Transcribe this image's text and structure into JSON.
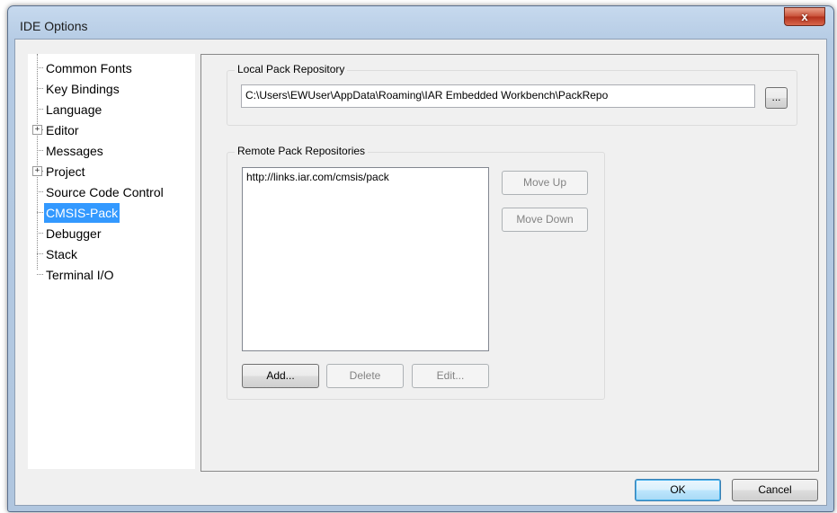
{
  "window": {
    "title": "IDE Options",
    "close_glyph": "x"
  },
  "tree": {
    "items": [
      {
        "label": "Common Fonts",
        "expandable": false,
        "selected": false
      },
      {
        "label": "Key Bindings",
        "expandable": false,
        "selected": false
      },
      {
        "label": "Language",
        "expandable": false,
        "selected": false
      },
      {
        "label": "Editor",
        "expandable": true,
        "selected": false
      },
      {
        "label": "Messages",
        "expandable": false,
        "selected": false
      },
      {
        "label": "Project",
        "expandable": true,
        "selected": false
      },
      {
        "label": "Source Code Control",
        "expandable": false,
        "selected": false
      },
      {
        "label": "CMSIS-Pack",
        "expandable": false,
        "selected": true
      },
      {
        "label": "Debugger",
        "expandable": false,
        "selected": false
      },
      {
        "label": "Stack",
        "expandable": false,
        "selected": false
      },
      {
        "label": "Terminal I/O",
        "expandable": false,
        "selected": false
      }
    ],
    "expander_glyph": "+"
  },
  "local": {
    "group_label": "Local Pack Repository",
    "path": "C:\\Users\\EWUser\\AppData\\Roaming\\IAR Embedded Workbench\\PackRepo",
    "browse_label": "..."
  },
  "remote": {
    "group_label": "Remote Pack Repositories",
    "items": [
      "http://links.iar.com/cmsis/pack"
    ],
    "move_up_label": "Move Up",
    "move_down_label": "Move Down",
    "add_label": "Add...",
    "delete_label": "Delete",
    "edit_label": "Edit..."
  },
  "footer": {
    "ok_label": "OK",
    "cancel_label": "Cancel"
  }
}
